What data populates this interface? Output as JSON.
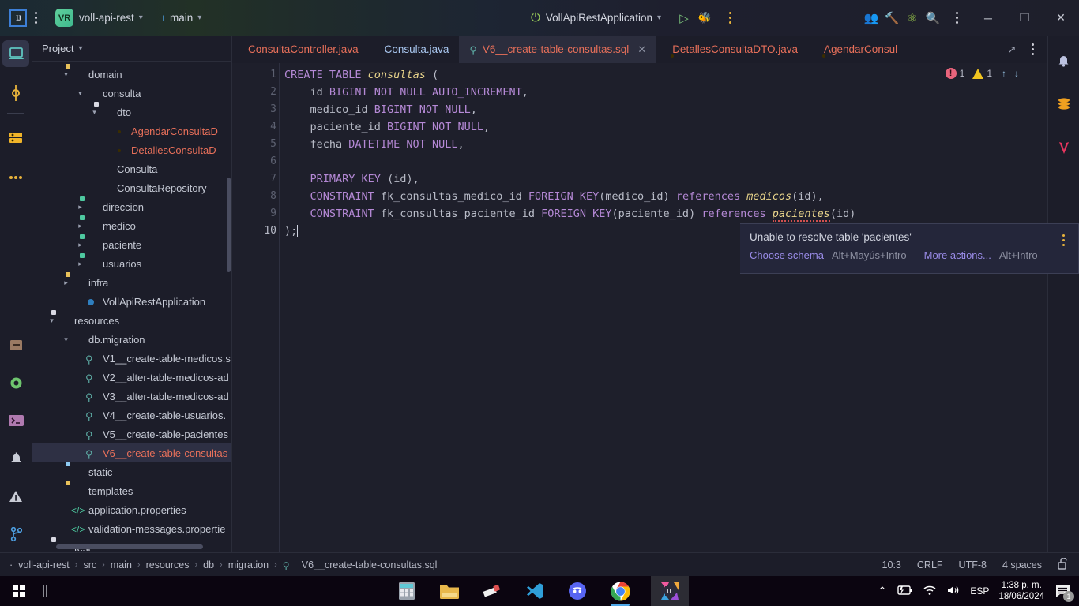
{
  "titlebar": {
    "ide_logo": "intellij-idea-logo",
    "project_initials": "VR",
    "project_name": "voll-api-rest",
    "branch_icon": "git-branch-icon",
    "branch_name": "main",
    "run_config_name": "VollApiRestApplication",
    "run_icon": "run-icon",
    "debug_icon": "debug-icon",
    "more_icon": "more-actions-icon",
    "collab_icon": "code-with-me-icon",
    "tools_icon": "build-tools-icon",
    "ai_icon": "ai-assistant-icon",
    "search_icon": "search-everywhere-icon",
    "settings_icon": "settings-kebab-icon",
    "minimize": "─",
    "maximize": "❐",
    "close": "✕"
  },
  "left_rail": {
    "items": [
      {
        "name": "project-tool-window",
        "icon": "project-window-icon",
        "active": true
      },
      {
        "name": "commit-tool-window",
        "icon": "commit-icon",
        "active": false
      },
      {
        "name": "database-tool-window",
        "icon": "database-icon",
        "active": false
      },
      {
        "name": "more-tool-windows",
        "icon": "more-dots-icon",
        "active": false
      }
    ],
    "bottom_items": [
      {
        "name": "build-tool-window",
        "icon": "build-package-icon"
      },
      {
        "name": "services-tool-window",
        "icon": "services-gear-icon"
      },
      {
        "name": "terminal-tool-window",
        "icon": "terminal-icon"
      },
      {
        "name": "problems-tool-window",
        "icon": "alarm-icon"
      },
      {
        "name": "warnings-tool-window",
        "icon": "warning-triangle-icon"
      },
      {
        "name": "version-control-tool-window",
        "icon": "git-branch-icon"
      }
    ]
  },
  "right_rail": {
    "items": [
      {
        "name": "notifications",
        "icon": "bell-icon"
      },
      {
        "name": "database",
        "icon": "database-stack-icon"
      },
      {
        "name": "maven",
        "icon": "maven-icon"
      }
    ]
  },
  "project_panel": {
    "title": "Project",
    "chevron": "⌄",
    "tree": [
      {
        "depth": 3,
        "arrow": "down",
        "icon": "folder-source-gray",
        "label": "domain",
        "color": "normal",
        "selected": false
      },
      {
        "depth": 4,
        "arrow": "down",
        "icon": "folder-package-blue",
        "label": "consulta",
        "color": "normal",
        "selected": false
      },
      {
        "depth": 5,
        "arrow": "down",
        "icon": "folder-source-green",
        "label": "dto",
        "color": "normal",
        "selected": false
      },
      {
        "depth": 6,
        "arrow": "none",
        "icon": "record-java",
        "label": "AgendarConsultaD",
        "color": "red",
        "selected": false
      },
      {
        "depth": 6,
        "arrow": "none",
        "icon": "record-java",
        "label": "DetallesConsultaD",
        "color": "red",
        "selected": false
      },
      {
        "depth": 5,
        "arrow": "none",
        "icon": "class-java",
        "label": "Consulta",
        "color": "normal",
        "selected": false
      },
      {
        "depth": 5,
        "arrow": "none",
        "icon": "interface-java",
        "label": "ConsultaRepository",
        "color": "normal",
        "selected": false
      },
      {
        "depth": 4,
        "arrow": "right",
        "icon": "folder-package-yellow",
        "label": "direccion",
        "color": "normal",
        "selected": false
      },
      {
        "depth": 4,
        "arrow": "right",
        "icon": "folder-package-yellow",
        "label": "medico",
        "color": "normal",
        "selected": false
      },
      {
        "depth": 4,
        "arrow": "right",
        "icon": "folder-package-yellow",
        "label": "paciente",
        "color": "normal",
        "selected": false
      },
      {
        "depth": 4,
        "arrow": "right",
        "icon": "folder-package-yellow",
        "label": "usuarios",
        "color": "normal",
        "selected": false
      },
      {
        "depth": 3,
        "arrow": "right",
        "icon": "folder-source-gray2",
        "label": "infra",
        "color": "normal",
        "selected": false
      },
      {
        "depth": 4,
        "arrow": "none",
        "icon": "spring-boot",
        "label": "VollApiRestApplication",
        "color": "normal",
        "selected": false
      },
      {
        "depth": 2,
        "arrow": "down",
        "icon": "folder-resources-purple",
        "label": "resources",
        "color": "normal",
        "selected": false
      },
      {
        "depth": 3,
        "arrow": "down",
        "icon": "folder-package-blue",
        "label": "db.migration",
        "color": "normal",
        "selected": false
      },
      {
        "depth": 4,
        "arrow": "none",
        "icon": "sql-file",
        "label": "V1__create-table-medicos.s",
        "color": "normal",
        "selected": false
      },
      {
        "depth": 4,
        "arrow": "none",
        "icon": "sql-file",
        "label": "V2__alter-table-medicos-ad",
        "color": "normal",
        "selected": false
      },
      {
        "depth": 4,
        "arrow": "none",
        "icon": "sql-file",
        "label": "V3__alter-table-medicos-ad",
        "color": "normal",
        "selected": false
      },
      {
        "depth": 4,
        "arrow": "none",
        "icon": "sql-file",
        "label": "V4__create-table-usuarios.",
        "color": "normal",
        "selected": false
      },
      {
        "depth": 4,
        "arrow": "none",
        "icon": "sql-file",
        "label": "V5__create-table-pacientes",
        "color": "normal",
        "selected": false
      },
      {
        "depth": 4,
        "arrow": "none",
        "icon": "sql-file",
        "label": "V6__create-table-consultas",
        "color": "red",
        "selected": true
      },
      {
        "depth": 3,
        "arrow": "none",
        "icon": "folder-static-blue",
        "label": "static",
        "color": "normal",
        "selected": false
      },
      {
        "depth": 3,
        "arrow": "none",
        "icon": "folder-templates-orange",
        "label": "templates",
        "color": "normal",
        "selected": false
      },
      {
        "depth": 3,
        "arrow": "none",
        "icon": "properties-file",
        "label": "application.properties",
        "color": "normal",
        "selected": false
      },
      {
        "depth": 3,
        "arrow": "none",
        "icon": "properties-file",
        "label": "validation-messages.propertie",
        "color": "normal",
        "selected": false
      },
      {
        "depth": 2,
        "arrow": "none",
        "icon": "folder-test-green",
        "label": "test",
        "color": "normal",
        "selected": false
      }
    ]
  },
  "editor": {
    "tabs": [
      {
        "label": "ConsultaController.java",
        "icon": "java-class-icon",
        "color": "red",
        "active": false,
        "closeable": false
      },
      {
        "label": "Consulta.java",
        "icon": "java-class-icon",
        "color": "blue",
        "active": false,
        "closeable": false
      },
      {
        "label": "V6__create-table-consultas.sql",
        "icon": "sql-file-icon",
        "color": "red",
        "active": true,
        "closeable": true
      },
      {
        "label": "DetallesConsultaDTO.java",
        "icon": "java-record-icon",
        "color": "red",
        "active": false,
        "closeable": false
      },
      {
        "label": "AgendarConsul",
        "icon": "java-record-icon",
        "color": "red",
        "active": false,
        "closeable": false
      }
    ],
    "tab_expand_icon": "expand-editor-icon",
    "tab_options_icon": "tab-options-icon",
    "inspection": {
      "error_count": "1",
      "warning_count": "1",
      "prev_icon": "↑",
      "next_icon": "↓"
    },
    "line_numbers": [
      "1",
      "2",
      "3",
      "4",
      "5",
      "6",
      "7",
      "8",
      "9",
      "10"
    ],
    "code_lines": [
      {
        "n": 1,
        "segments": [
          {
            "t": "CREATE TABLE ",
            "c": "kw"
          },
          {
            "t": "consultas",
            "c": "tbl"
          },
          {
            "t": " (",
            "c": "pl"
          }
        ]
      },
      {
        "n": 2,
        "segments": [
          {
            "t": "    id ",
            "c": "pl"
          },
          {
            "t": "BIGINT NOT NULL AUTO_INCREMENT",
            "c": "kw"
          },
          {
            "t": ",",
            "c": "pl"
          }
        ]
      },
      {
        "n": 3,
        "segments": [
          {
            "t": "    medico_id ",
            "c": "pl"
          },
          {
            "t": "BIGINT NOT NULL",
            "c": "kw"
          },
          {
            "t": ",",
            "c": "pl"
          }
        ]
      },
      {
        "n": 4,
        "segments": [
          {
            "t": "    paciente_id ",
            "c": "pl"
          },
          {
            "t": "BIGINT NOT NULL",
            "c": "kw"
          },
          {
            "t": ",",
            "c": "pl"
          }
        ]
      },
      {
        "n": 5,
        "segments": [
          {
            "t": "    fecha ",
            "c": "pl"
          },
          {
            "t": "DATETIME NOT NULL",
            "c": "kw"
          },
          {
            "t": ",",
            "c": "pl"
          }
        ]
      },
      {
        "n": 6,
        "segments": [
          {
            "t": "",
            "c": "pl"
          }
        ]
      },
      {
        "n": 7,
        "segments": [
          {
            "t": "    ",
            "c": "pl"
          },
          {
            "t": "PRIMARY KEY ",
            "c": "kw"
          },
          {
            "t": "(id),",
            "c": "pl"
          }
        ]
      },
      {
        "n": 8,
        "segments": [
          {
            "t": "    ",
            "c": "pl"
          },
          {
            "t": "CONSTRAINT ",
            "c": "kw"
          },
          {
            "t": "fk_consultas_medico_id ",
            "c": "pl"
          },
          {
            "t": "FOREIGN KEY",
            "c": "kw"
          },
          {
            "t": "(medico_id) ",
            "c": "pl"
          },
          {
            "t": "references ",
            "c": "kw"
          },
          {
            "t": "medicos",
            "c": "tbl"
          },
          {
            "t": "(id),",
            "c": "pl"
          }
        ]
      },
      {
        "n": 9,
        "segments": [
          {
            "t": "    ",
            "c": "pl"
          },
          {
            "t": "CONSTRAINT ",
            "c": "kw"
          },
          {
            "t": "fk_consultas_paciente_id ",
            "c": "pl"
          },
          {
            "t": "FOREIGN KEY",
            "c": "kw"
          },
          {
            "t": "(paciente_id) ",
            "c": "pl"
          },
          {
            "t": "references ",
            "c": "kw"
          },
          {
            "t": "pacientes",
            "c": "tbl-err"
          },
          {
            "t": "(id)",
            "c": "pl"
          }
        ]
      },
      {
        "n": 10,
        "segments": [
          {
            "t": ");",
            "c": "pl"
          }
        ]
      }
    ]
  },
  "error_popup": {
    "message": "Unable to resolve table 'pacientes'",
    "action_primary": "Choose schema",
    "shortcut_primary": "Alt+Mayús+Intro",
    "action_secondary": "More actions...",
    "shortcut_secondary": "Alt+Intro",
    "kebab_icon": "popup-options-icon"
  },
  "statusbar": {
    "breadcrumbs": [
      "voll-api-rest",
      "src",
      "main",
      "resources",
      "db",
      "migration",
      "V6__create-table-consultas.sql"
    ],
    "breadcrumb_leading_dot": "·",
    "separator": "›",
    "file_icon": "sql-file-icon",
    "caret_position": "10:3",
    "line_separator": "CRLF",
    "encoding": "UTF-8",
    "indent": "4 spaces",
    "lock_icon": "unlocked-icon"
  },
  "taskbar": {
    "start_icon": "windows-start-icon",
    "task_view_icon": "task-view-icon",
    "apps": [
      {
        "name": "calculator",
        "icon": "calculator-icon"
      },
      {
        "name": "file-explorer",
        "icon": "folder-icon"
      },
      {
        "name": "paint",
        "icon": "paint-icon"
      },
      {
        "name": "vs-code",
        "icon": "vscode-icon"
      },
      {
        "name": "discord",
        "icon": "discord-icon"
      },
      {
        "name": "google-chrome",
        "icon": "chrome-icon"
      },
      {
        "name": "intellij-idea",
        "icon": "intellij-icon"
      }
    ],
    "tray": {
      "chevron": "⌃",
      "battery_icon": "battery-charging-icon",
      "wifi_icon": "wifi-icon",
      "volume_icon": "speaker-icon",
      "language": "ESP",
      "time": "1:38 p. m.",
      "date": "18/06/2024",
      "notification_count": "1"
    }
  },
  "colors": {
    "accent_blue": "#4d9ee0",
    "string_red": "#e8705a",
    "keyword_purple": "#b589d6",
    "table_yellow": "#e8d48b",
    "bg_dark": "#1e1f2b",
    "panel_bg": "#1c1d29",
    "selection": "#2e3044"
  }
}
